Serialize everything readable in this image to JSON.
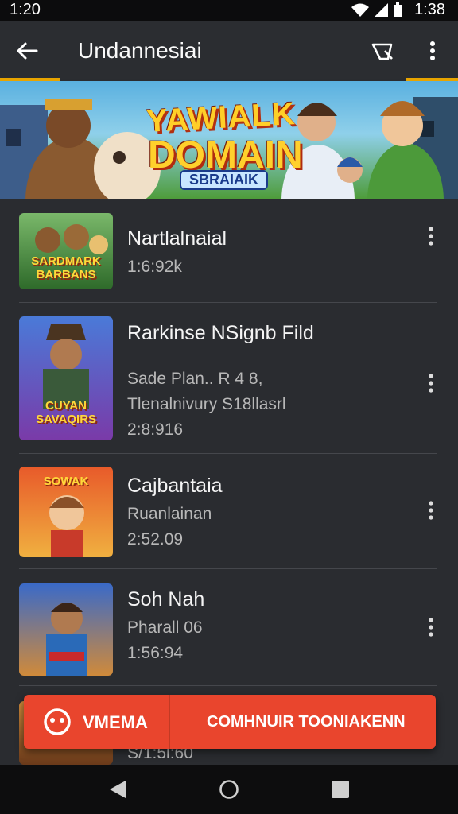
{
  "status_bar": {
    "time_left": "1:20",
    "time_right": "1:38"
  },
  "app_bar": {
    "title": "Undannesiai"
  },
  "banner": {
    "line1": "YAWIALK",
    "line2": "DOMAIN",
    "subtitle": "SBRAIAIK"
  },
  "items": [
    {
      "title": "Nartlalnaial",
      "lines": [
        "1:6:92k"
      ],
      "thumb_caption": "SARDMARK BARBANS"
    },
    {
      "title": "Rarkinse NSignb Fild",
      "lines": [
        "Sade Plan..  R 4 8,",
        "Tlenalnivury S18llasrl",
        "2:8:916"
      ],
      "thumb_caption": "CUYAN SAVAQIRS"
    },
    {
      "title": "Cajbantaia",
      "lines": [
        "Ruanlainan",
        "2:52.09"
      ],
      "thumb_caption": "SOWAK"
    },
    {
      "title": "Soh Nah",
      "lines": [
        "Pharall 06",
        "1:56:94"
      ],
      "thumb_caption": ""
    },
    {
      "title": "",
      "lines": [
        "S/1:5l:60"
      ],
      "thumb_caption": ""
    }
  ],
  "cta": {
    "left_label": "VMEMA",
    "right_label": "COMHNUIR TOONIAKENN"
  },
  "colors": {
    "accent": "#e8a400",
    "cta": "#e9452d",
    "background": "#2a2c30"
  }
}
